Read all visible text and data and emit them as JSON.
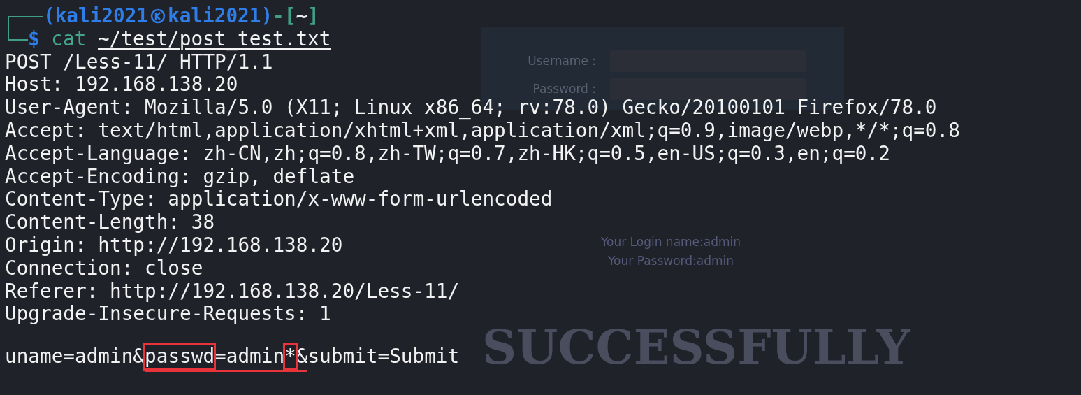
{
  "background_page": {
    "username_label": "Username :",
    "password_label": "Password :",
    "login_name": "Your Login name:admin",
    "password_line": "Your Password:admin",
    "banner": "SUCCESSFULLY"
  },
  "prompt_tokens": [
    {
      "kind": "user",
      "text": "(kali2021"
    },
    {
      "kind": "icon"
    },
    {
      "kind": "user",
      "text": "kali2021)"
    },
    {
      "kind": "frame",
      "text": "-["
    },
    {
      "kind": "path",
      "text": "~"
    },
    {
      "kind": "frame",
      "text": "]"
    }
  ],
  "command": {
    "symbol": "$",
    "name": "cat",
    "argument": "~/test/post_test.txt"
  },
  "output_lines": [
    "POST /Less-11/ HTTP/1.1",
    "Host: 192.168.138.20",
    "User-Agent: Mozilla/5.0 (X11; Linux x86_64; rv:78.0) Gecko/20100101 Firefox/78.0",
    "Accept: text/html,application/xhtml+xml,application/xml;q=0.9,image/webp,*/*;q=0.8",
    "Accept-Language: zh-CN,zh;q=0.8,zh-TW;q=0.7,zh-HK;q=0.5,en-US;q=0.3,en;q=0.2",
    "Accept-Encoding: gzip, deflate",
    "Content-Type: application/x-www-form-urlencoded",
    "Content-Length: 38",
    "Origin: http://192.168.138.20",
    "Connection: close",
    "Referer: http://192.168.138.20/Less-11/",
    "Upgrade-Insecure-Requests: 1"
  ],
  "body_segments": [
    {
      "text": "uname=admin&",
      "highlighted": false
    },
    {
      "text": "passwd",
      "highlighted": true
    },
    {
      "text": "=admin",
      "highlighted": false
    },
    {
      "text": "*",
      "highlighted": true
    },
    {
      "text": "&submit=Submit",
      "highlighted": false
    }
  ]
}
